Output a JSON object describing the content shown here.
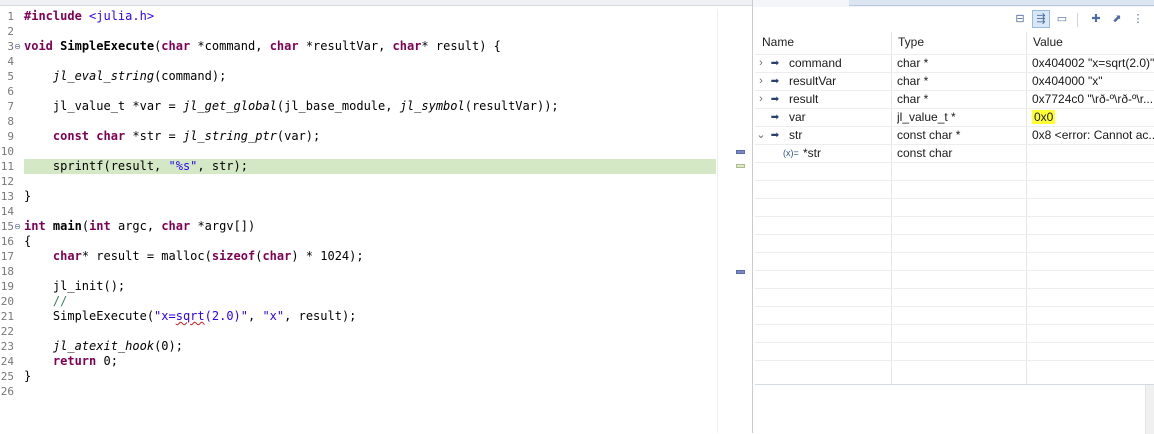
{
  "editor": {
    "lines": [
      {
        "n": "1",
        "fold": "",
        "hl": false,
        "segs": [
          {
            "c": "kw",
            "t": "#include"
          },
          {
            "c": "",
            "t": " "
          },
          {
            "c": "str",
            "t": "<julia.h>"
          }
        ]
      },
      {
        "n": "2",
        "fold": "",
        "hl": false,
        "segs": []
      },
      {
        "n": "3",
        "fold": "⊖",
        "hl": false,
        "segs": [
          {
            "c": "kw",
            "t": "void"
          },
          {
            "c": "",
            "t": " "
          },
          {
            "c": "fn",
            "t": "SimpleExecute"
          },
          {
            "c": "",
            "t": "("
          },
          {
            "c": "kw",
            "t": "char"
          },
          {
            "c": "",
            "t": " *command, "
          },
          {
            "c": "kw",
            "t": "char"
          },
          {
            "c": "",
            "t": " *resultVar, "
          },
          {
            "c": "kw",
            "t": "char"
          },
          {
            "c": "",
            "t": "* result) {"
          }
        ]
      },
      {
        "n": "4",
        "fold": "",
        "hl": false,
        "segs": []
      },
      {
        "n": "5",
        "fold": "",
        "hl": false,
        "segs": [
          {
            "c": "",
            "t": "    "
          },
          {
            "c": "it",
            "t": "jl_eval_string"
          },
          {
            "c": "",
            "t": "(command);"
          }
        ]
      },
      {
        "n": "6",
        "fold": "",
        "hl": false,
        "segs": []
      },
      {
        "n": "7",
        "fold": "",
        "hl": false,
        "segs": [
          {
            "c": "",
            "t": "    jl_value_t *var = "
          },
          {
            "c": "it",
            "t": "jl_get_global"
          },
          {
            "c": "",
            "t": "(jl_base_module, "
          },
          {
            "c": "it",
            "t": "jl_symbol"
          },
          {
            "c": "",
            "t": "(resultVar));"
          }
        ]
      },
      {
        "n": "8",
        "fold": "",
        "hl": false,
        "segs": []
      },
      {
        "n": "9",
        "fold": "",
        "hl": false,
        "segs": [
          {
            "c": "",
            "t": "    "
          },
          {
            "c": "kw",
            "t": "const"
          },
          {
            "c": "",
            "t": " "
          },
          {
            "c": "kw",
            "t": "char"
          },
          {
            "c": "",
            "t": " *str = "
          },
          {
            "c": "it",
            "t": "jl_string_ptr"
          },
          {
            "c": "",
            "t": "(var);"
          }
        ]
      },
      {
        "n": "10",
        "fold": "",
        "hl": false,
        "segs": []
      },
      {
        "n": "11",
        "fold": "",
        "hl": true,
        "segs": [
          {
            "c": "",
            "t": "    sprintf(result, "
          },
          {
            "c": "str",
            "t": "\"%s\""
          },
          {
            "c": "",
            "t": ", str);"
          }
        ]
      },
      {
        "n": "12",
        "fold": "",
        "hl": false,
        "segs": []
      },
      {
        "n": "13",
        "fold": "",
        "hl": false,
        "segs": [
          {
            "c": "",
            "t": "}"
          }
        ]
      },
      {
        "n": "14",
        "fold": "",
        "hl": false,
        "segs": []
      },
      {
        "n": "15",
        "fold": "⊖",
        "hl": false,
        "segs": [
          {
            "c": "kw",
            "t": "int"
          },
          {
            "c": "",
            "t": " "
          },
          {
            "c": "fn",
            "t": "main"
          },
          {
            "c": "",
            "t": "("
          },
          {
            "c": "kw",
            "t": "int"
          },
          {
            "c": "",
            "t": " argc, "
          },
          {
            "c": "kw",
            "t": "char"
          },
          {
            "c": "",
            "t": " *argv[])"
          }
        ]
      },
      {
        "n": "16",
        "fold": "",
        "hl": false,
        "segs": [
          {
            "c": "",
            "t": "{"
          }
        ]
      },
      {
        "n": "17",
        "fold": "",
        "hl": false,
        "segs": [
          {
            "c": "",
            "t": "    "
          },
          {
            "c": "kw",
            "t": "char"
          },
          {
            "c": "",
            "t": "* result = malloc("
          },
          {
            "c": "kw",
            "t": "sizeof"
          },
          {
            "c": "",
            "t": "("
          },
          {
            "c": "kw",
            "t": "char"
          },
          {
            "c": "",
            "t": ") * 1024);"
          }
        ]
      },
      {
        "n": "18",
        "fold": "",
        "hl": false,
        "segs": []
      },
      {
        "n": "19",
        "fold": "",
        "hl": false,
        "segs": [
          {
            "c": "",
            "t": "    jl_init();"
          }
        ]
      },
      {
        "n": "20",
        "fold": "",
        "hl": false,
        "segs": [
          {
            "c": "",
            "t": "    "
          },
          {
            "c": "cm",
            "t": "//"
          }
        ]
      },
      {
        "n": "21",
        "fold": "",
        "hl": false,
        "segs": [
          {
            "c": "",
            "t": "    SimpleExecute("
          },
          {
            "c": "str",
            "t": "\"x="
          },
          {
            "c": "str sq",
            "t": "sqrt"
          },
          {
            "c": "str",
            "t": "(2.0)\""
          },
          {
            "c": "",
            "t": ", "
          },
          {
            "c": "str",
            "t": "\"x\""
          },
          {
            "c": "",
            "t": ", result);"
          }
        ]
      },
      {
        "n": "22",
        "fold": "",
        "hl": false,
        "segs": []
      },
      {
        "n": "23",
        "fold": "",
        "hl": false,
        "segs": [
          {
            "c": "",
            "t": "    "
          },
          {
            "c": "it",
            "t": "jl_atexit_hook"
          },
          {
            "c": "",
            "t": "(0);"
          }
        ]
      },
      {
        "n": "24",
        "fold": "",
        "hl": false,
        "segs": [
          {
            "c": "",
            "t": "    "
          },
          {
            "c": "kw",
            "t": "return"
          },
          {
            "c": "",
            "t": " 0;"
          }
        ]
      },
      {
        "n": "25",
        "fold": "",
        "hl": false,
        "segs": [
          {
            "c": "",
            "t": "}"
          }
        ]
      },
      {
        "n": "26",
        "fold": "",
        "hl": false,
        "segs": []
      }
    ]
  },
  "variables": {
    "toolbar_icons": [
      "collapse-all-icon",
      "show-type-names-icon",
      "layout-icon",
      "new-expression-icon",
      "export-icon",
      "view-menu-icon"
    ],
    "columns": [
      "Name",
      "Type",
      "Value"
    ],
    "rows": [
      {
        "twisty": "›",
        "icon": "➡",
        "name": "command",
        "type": "char *",
        "value": "0x404002 \"x=sqrt(2.0)\"",
        "highlight": false
      },
      {
        "twisty": "›",
        "icon": "➡",
        "name": "resultVar",
        "type": "char *",
        "value": "0x404000 \"x\"",
        "highlight": false
      },
      {
        "twisty": "›",
        "icon": "➡",
        "name": "result",
        "type": "char *",
        "value": "0x7724c0 \"\\rð-º\\rð-º\\r...",
        "highlight": false
      },
      {
        "twisty": "",
        "icon": "➡",
        "name": "var",
        "type": "jl_value_t *",
        "value": "0x0",
        "highlight": true
      },
      {
        "twisty": "⌄",
        "icon": "➡",
        "name": "str",
        "type": "const char *",
        "value": "0x8 <error: Cannot ac...",
        "highlight": false
      },
      {
        "twisty": "",
        "icon": "(x)=",
        "name": "*str",
        "type": "const char",
        "value": "",
        "highlight": false,
        "child": true
      }
    ],
    "empty_rows": 12,
    "highlight_color": "#ffff33"
  }
}
